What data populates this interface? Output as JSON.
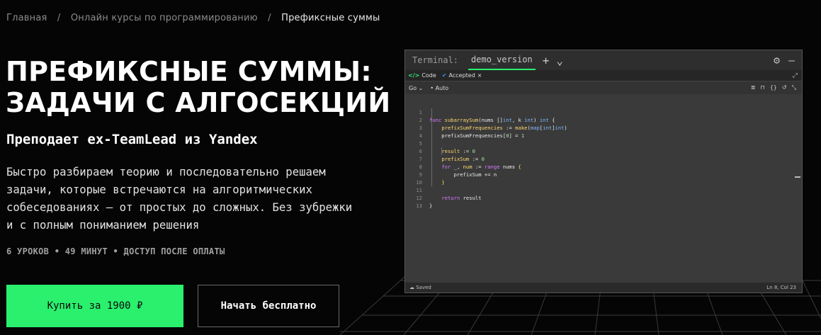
{
  "breadcrumb": {
    "home": "Главная",
    "separator": "/",
    "courses": "Онлайн курсы по программированию",
    "current": "Префиксные суммы"
  },
  "hero": {
    "title_line1": "ПРЕФИКСНЫЕ СУММЫ:",
    "title_line2": "ЗАДАЧИ С АЛГОСЕКЦИЙ",
    "subtitle": "Преподает ex-TeamLead из Yandex",
    "description": "Быстро разбираем теорию и последовательно решаем задачи, которые встречаются на алгоритмических собеседованиях — от простых до сложных. Без зубрежки и с полным пониманием решения",
    "meta": "6 УРОКОВ • 49 МИНУТ • ДОСТУП ПОСЛЕ ОПЛАТЫ"
  },
  "buttons": {
    "buy_label": "Купить за 1900 ₽",
    "free_label": "Начать бесплатно"
  },
  "terminal": {
    "label": "Terminal:",
    "tab": "demo_version",
    "add_icon": "+",
    "chevron_icon": "⌄",
    "settings_icon": "⚙",
    "minimize_icon": "–",
    "editor_tab_code": "Code",
    "editor_tab_accepted": "Accepted",
    "close_icon": "×",
    "language": "Go",
    "language_chevron": "⌄",
    "mode": "Auto",
    "status_saved": "Saved",
    "status_position": "Ln 8, Col 23"
  },
  "code": {
    "line_numbers": [
      "1",
      "2",
      "3",
      "4",
      "5",
      "6",
      "7",
      "8",
      "9",
      "10",
      "11",
      "12",
      "13"
    ]
  },
  "colors": {
    "accent_green": "#2af06e",
    "background": "#050505",
    "terminal_bg": "#3a3a3a"
  }
}
